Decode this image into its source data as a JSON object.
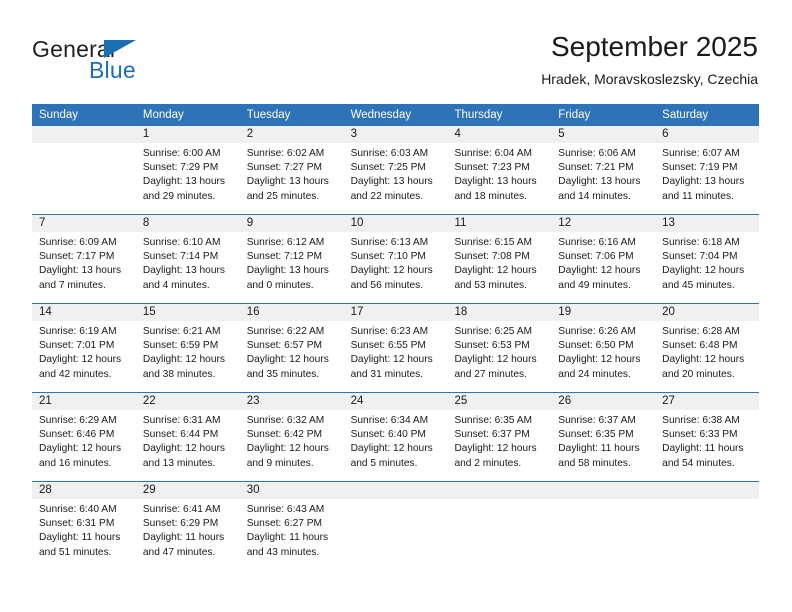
{
  "brand": {
    "name_part1": "General",
    "name_part2": "Blue",
    "accent_color": "#1b6fb5"
  },
  "header": {
    "title": "September 2025",
    "subtitle": "Hradek, Moravskoslezsky, Czechia"
  },
  "theme": {
    "header_blue": "#2E72B8",
    "day_band_gray": "#F0F0F0"
  },
  "weekdays": [
    "Sunday",
    "Monday",
    "Tuesday",
    "Wednesday",
    "Thursday",
    "Friday",
    "Saturday"
  ],
  "weeks": [
    [
      {
        "day": "",
        "sunrise": "",
        "sunset": "",
        "daylight": ""
      },
      {
        "day": "1",
        "sunrise": "Sunrise: 6:00 AM",
        "sunset": "Sunset: 7:29 PM",
        "daylight": "Daylight: 13 hours and 29 minutes."
      },
      {
        "day": "2",
        "sunrise": "Sunrise: 6:02 AM",
        "sunset": "Sunset: 7:27 PM",
        "daylight": "Daylight: 13 hours and 25 minutes."
      },
      {
        "day": "3",
        "sunrise": "Sunrise: 6:03 AM",
        "sunset": "Sunset: 7:25 PM",
        "daylight": "Daylight: 13 hours and 22 minutes."
      },
      {
        "day": "4",
        "sunrise": "Sunrise: 6:04 AM",
        "sunset": "Sunset: 7:23 PM",
        "daylight": "Daylight: 13 hours and 18 minutes."
      },
      {
        "day": "5",
        "sunrise": "Sunrise: 6:06 AM",
        "sunset": "Sunset: 7:21 PM",
        "daylight": "Daylight: 13 hours and 14 minutes."
      },
      {
        "day": "6",
        "sunrise": "Sunrise: 6:07 AM",
        "sunset": "Sunset: 7:19 PM",
        "daylight": "Daylight: 13 hours and 11 minutes."
      }
    ],
    [
      {
        "day": "7",
        "sunrise": "Sunrise: 6:09 AM",
        "sunset": "Sunset: 7:17 PM",
        "daylight": "Daylight: 13 hours and 7 minutes."
      },
      {
        "day": "8",
        "sunrise": "Sunrise: 6:10 AM",
        "sunset": "Sunset: 7:14 PM",
        "daylight": "Daylight: 13 hours and 4 minutes."
      },
      {
        "day": "9",
        "sunrise": "Sunrise: 6:12 AM",
        "sunset": "Sunset: 7:12 PM",
        "daylight": "Daylight: 13 hours and 0 minutes."
      },
      {
        "day": "10",
        "sunrise": "Sunrise: 6:13 AM",
        "sunset": "Sunset: 7:10 PM",
        "daylight": "Daylight: 12 hours and 56 minutes."
      },
      {
        "day": "11",
        "sunrise": "Sunrise: 6:15 AM",
        "sunset": "Sunset: 7:08 PM",
        "daylight": "Daylight: 12 hours and 53 minutes."
      },
      {
        "day": "12",
        "sunrise": "Sunrise: 6:16 AM",
        "sunset": "Sunset: 7:06 PM",
        "daylight": "Daylight: 12 hours and 49 minutes."
      },
      {
        "day": "13",
        "sunrise": "Sunrise: 6:18 AM",
        "sunset": "Sunset: 7:04 PM",
        "daylight": "Daylight: 12 hours and 45 minutes."
      }
    ],
    [
      {
        "day": "14",
        "sunrise": "Sunrise: 6:19 AM",
        "sunset": "Sunset: 7:01 PM",
        "daylight": "Daylight: 12 hours and 42 minutes."
      },
      {
        "day": "15",
        "sunrise": "Sunrise: 6:21 AM",
        "sunset": "Sunset: 6:59 PM",
        "daylight": "Daylight: 12 hours and 38 minutes."
      },
      {
        "day": "16",
        "sunrise": "Sunrise: 6:22 AM",
        "sunset": "Sunset: 6:57 PM",
        "daylight": "Daylight: 12 hours and 35 minutes."
      },
      {
        "day": "17",
        "sunrise": "Sunrise: 6:23 AM",
        "sunset": "Sunset: 6:55 PM",
        "daylight": "Daylight: 12 hours and 31 minutes."
      },
      {
        "day": "18",
        "sunrise": "Sunrise: 6:25 AM",
        "sunset": "Sunset: 6:53 PM",
        "daylight": "Daylight: 12 hours and 27 minutes."
      },
      {
        "day": "19",
        "sunrise": "Sunrise: 6:26 AM",
        "sunset": "Sunset: 6:50 PM",
        "daylight": "Daylight: 12 hours and 24 minutes."
      },
      {
        "day": "20",
        "sunrise": "Sunrise: 6:28 AM",
        "sunset": "Sunset: 6:48 PM",
        "daylight": "Daylight: 12 hours and 20 minutes."
      }
    ],
    [
      {
        "day": "21",
        "sunrise": "Sunrise: 6:29 AM",
        "sunset": "Sunset: 6:46 PM",
        "daylight": "Daylight: 12 hours and 16 minutes."
      },
      {
        "day": "22",
        "sunrise": "Sunrise: 6:31 AM",
        "sunset": "Sunset: 6:44 PM",
        "daylight": "Daylight: 12 hours and 13 minutes."
      },
      {
        "day": "23",
        "sunrise": "Sunrise: 6:32 AM",
        "sunset": "Sunset: 6:42 PM",
        "daylight": "Daylight: 12 hours and 9 minutes."
      },
      {
        "day": "24",
        "sunrise": "Sunrise: 6:34 AM",
        "sunset": "Sunset: 6:40 PM",
        "daylight": "Daylight: 12 hours and 5 minutes."
      },
      {
        "day": "25",
        "sunrise": "Sunrise: 6:35 AM",
        "sunset": "Sunset: 6:37 PM",
        "daylight": "Daylight: 12 hours and 2 minutes."
      },
      {
        "day": "26",
        "sunrise": "Sunrise: 6:37 AM",
        "sunset": "Sunset: 6:35 PM",
        "daylight": "Daylight: 11 hours and 58 minutes."
      },
      {
        "day": "27",
        "sunrise": "Sunrise: 6:38 AM",
        "sunset": "Sunset: 6:33 PM",
        "daylight": "Daylight: 11 hours and 54 minutes."
      }
    ],
    [
      {
        "day": "28",
        "sunrise": "Sunrise: 6:40 AM",
        "sunset": "Sunset: 6:31 PM",
        "daylight": "Daylight: 11 hours and 51 minutes."
      },
      {
        "day": "29",
        "sunrise": "Sunrise: 6:41 AM",
        "sunset": "Sunset: 6:29 PM",
        "daylight": "Daylight: 11 hours and 47 minutes."
      },
      {
        "day": "30",
        "sunrise": "Sunrise: 6:43 AM",
        "sunset": "Sunset: 6:27 PM",
        "daylight": "Daylight: 11 hours and 43 minutes."
      },
      {
        "day": "",
        "sunrise": "",
        "sunset": "",
        "daylight": ""
      },
      {
        "day": "",
        "sunrise": "",
        "sunset": "",
        "daylight": ""
      },
      {
        "day": "",
        "sunrise": "",
        "sunset": "",
        "daylight": ""
      },
      {
        "day": "",
        "sunrise": "",
        "sunset": "",
        "daylight": ""
      }
    ]
  ]
}
